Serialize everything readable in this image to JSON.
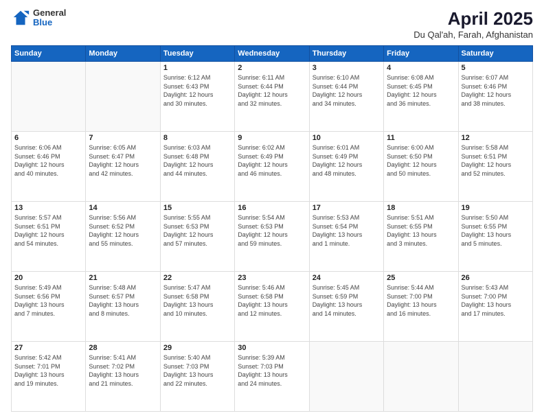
{
  "header": {
    "logo_general": "General",
    "logo_blue": "Blue",
    "title": "April 2025",
    "subtitle": "Du Qal'ah, Farah, Afghanistan"
  },
  "calendar": {
    "days_of_week": [
      "Sunday",
      "Monday",
      "Tuesday",
      "Wednesday",
      "Thursday",
      "Friday",
      "Saturday"
    ],
    "weeks": [
      [
        {
          "day": "",
          "info": ""
        },
        {
          "day": "",
          "info": ""
        },
        {
          "day": "1",
          "info": "Sunrise: 6:12 AM\nSunset: 6:43 PM\nDaylight: 12 hours\nand 30 minutes."
        },
        {
          "day": "2",
          "info": "Sunrise: 6:11 AM\nSunset: 6:44 PM\nDaylight: 12 hours\nand 32 minutes."
        },
        {
          "day": "3",
          "info": "Sunrise: 6:10 AM\nSunset: 6:44 PM\nDaylight: 12 hours\nand 34 minutes."
        },
        {
          "day": "4",
          "info": "Sunrise: 6:08 AM\nSunset: 6:45 PM\nDaylight: 12 hours\nand 36 minutes."
        },
        {
          "day": "5",
          "info": "Sunrise: 6:07 AM\nSunset: 6:46 PM\nDaylight: 12 hours\nand 38 minutes."
        }
      ],
      [
        {
          "day": "6",
          "info": "Sunrise: 6:06 AM\nSunset: 6:46 PM\nDaylight: 12 hours\nand 40 minutes."
        },
        {
          "day": "7",
          "info": "Sunrise: 6:05 AM\nSunset: 6:47 PM\nDaylight: 12 hours\nand 42 minutes."
        },
        {
          "day": "8",
          "info": "Sunrise: 6:03 AM\nSunset: 6:48 PM\nDaylight: 12 hours\nand 44 minutes."
        },
        {
          "day": "9",
          "info": "Sunrise: 6:02 AM\nSunset: 6:49 PM\nDaylight: 12 hours\nand 46 minutes."
        },
        {
          "day": "10",
          "info": "Sunrise: 6:01 AM\nSunset: 6:49 PM\nDaylight: 12 hours\nand 48 minutes."
        },
        {
          "day": "11",
          "info": "Sunrise: 6:00 AM\nSunset: 6:50 PM\nDaylight: 12 hours\nand 50 minutes."
        },
        {
          "day": "12",
          "info": "Sunrise: 5:58 AM\nSunset: 6:51 PM\nDaylight: 12 hours\nand 52 minutes."
        }
      ],
      [
        {
          "day": "13",
          "info": "Sunrise: 5:57 AM\nSunset: 6:51 PM\nDaylight: 12 hours\nand 54 minutes."
        },
        {
          "day": "14",
          "info": "Sunrise: 5:56 AM\nSunset: 6:52 PM\nDaylight: 12 hours\nand 55 minutes."
        },
        {
          "day": "15",
          "info": "Sunrise: 5:55 AM\nSunset: 6:53 PM\nDaylight: 12 hours\nand 57 minutes."
        },
        {
          "day": "16",
          "info": "Sunrise: 5:54 AM\nSunset: 6:53 PM\nDaylight: 12 hours\nand 59 minutes."
        },
        {
          "day": "17",
          "info": "Sunrise: 5:53 AM\nSunset: 6:54 PM\nDaylight: 13 hours\nand 1 minute."
        },
        {
          "day": "18",
          "info": "Sunrise: 5:51 AM\nSunset: 6:55 PM\nDaylight: 13 hours\nand 3 minutes."
        },
        {
          "day": "19",
          "info": "Sunrise: 5:50 AM\nSunset: 6:55 PM\nDaylight: 13 hours\nand 5 minutes."
        }
      ],
      [
        {
          "day": "20",
          "info": "Sunrise: 5:49 AM\nSunset: 6:56 PM\nDaylight: 13 hours\nand 7 minutes."
        },
        {
          "day": "21",
          "info": "Sunrise: 5:48 AM\nSunset: 6:57 PM\nDaylight: 13 hours\nand 8 minutes."
        },
        {
          "day": "22",
          "info": "Sunrise: 5:47 AM\nSunset: 6:58 PM\nDaylight: 13 hours\nand 10 minutes."
        },
        {
          "day": "23",
          "info": "Sunrise: 5:46 AM\nSunset: 6:58 PM\nDaylight: 13 hours\nand 12 minutes."
        },
        {
          "day": "24",
          "info": "Sunrise: 5:45 AM\nSunset: 6:59 PM\nDaylight: 13 hours\nand 14 minutes."
        },
        {
          "day": "25",
          "info": "Sunrise: 5:44 AM\nSunset: 7:00 PM\nDaylight: 13 hours\nand 16 minutes."
        },
        {
          "day": "26",
          "info": "Sunrise: 5:43 AM\nSunset: 7:00 PM\nDaylight: 13 hours\nand 17 minutes."
        }
      ],
      [
        {
          "day": "27",
          "info": "Sunrise: 5:42 AM\nSunset: 7:01 PM\nDaylight: 13 hours\nand 19 minutes."
        },
        {
          "day": "28",
          "info": "Sunrise: 5:41 AM\nSunset: 7:02 PM\nDaylight: 13 hours\nand 21 minutes."
        },
        {
          "day": "29",
          "info": "Sunrise: 5:40 AM\nSunset: 7:03 PM\nDaylight: 13 hours\nand 22 minutes."
        },
        {
          "day": "30",
          "info": "Sunrise: 5:39 AM\nSunset: 7:03 PM\nDaylight: 13 hours\nand 24 minutes."
        },
        {
          "day": "",
          "info": ""
        },
        {
          "day": "",
          "info": ""
        },
        {
          "day": "",
          "info": ""
        }
      ]
    ]
  }
}
